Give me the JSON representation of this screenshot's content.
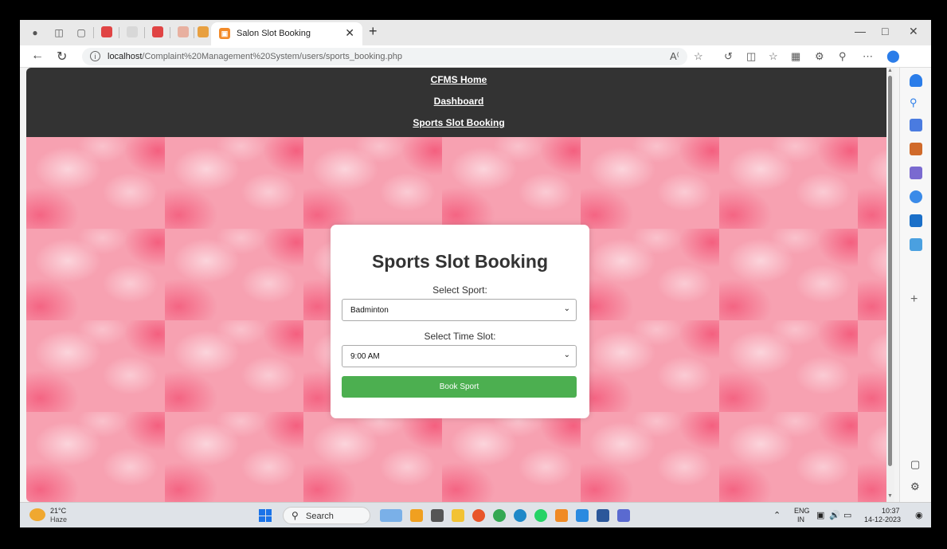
{
  "browser": {
    "active_tab_title": "Salon Slot Booking",
    "url_host": "localhost",
    "url_path": "/Complaint%20Management%20System/users/sports_booking.php"
  },
  "nav": {
    "home": "CFMS Home",
    "dashboard": "Dashboard",
    "sports": "Sports Slot Booking"
  },
  "form": {
    "title": "Sports Slot Booking",
    "sport_label": "Select Sport:",
    "sport_value": "Badminton",
    "slot_label": "Select Time Slot:",
    "slot_value": "9:00 AM",
    "button": "Book Sport"
  },
  "taskbar": {
    "temp": "21°C",
    "condition": "Haze",
    "search": "Search",
    "lang_top": "ENG",
    "lang_bottom": "IN",
    "time": "10:37",
    "date": "14-12-2023"
  },
  "colors": {
    "navbar": "#333333",
    "button": "#4caf50",
    "background_pink": "#f7a1b1"
  }
}
